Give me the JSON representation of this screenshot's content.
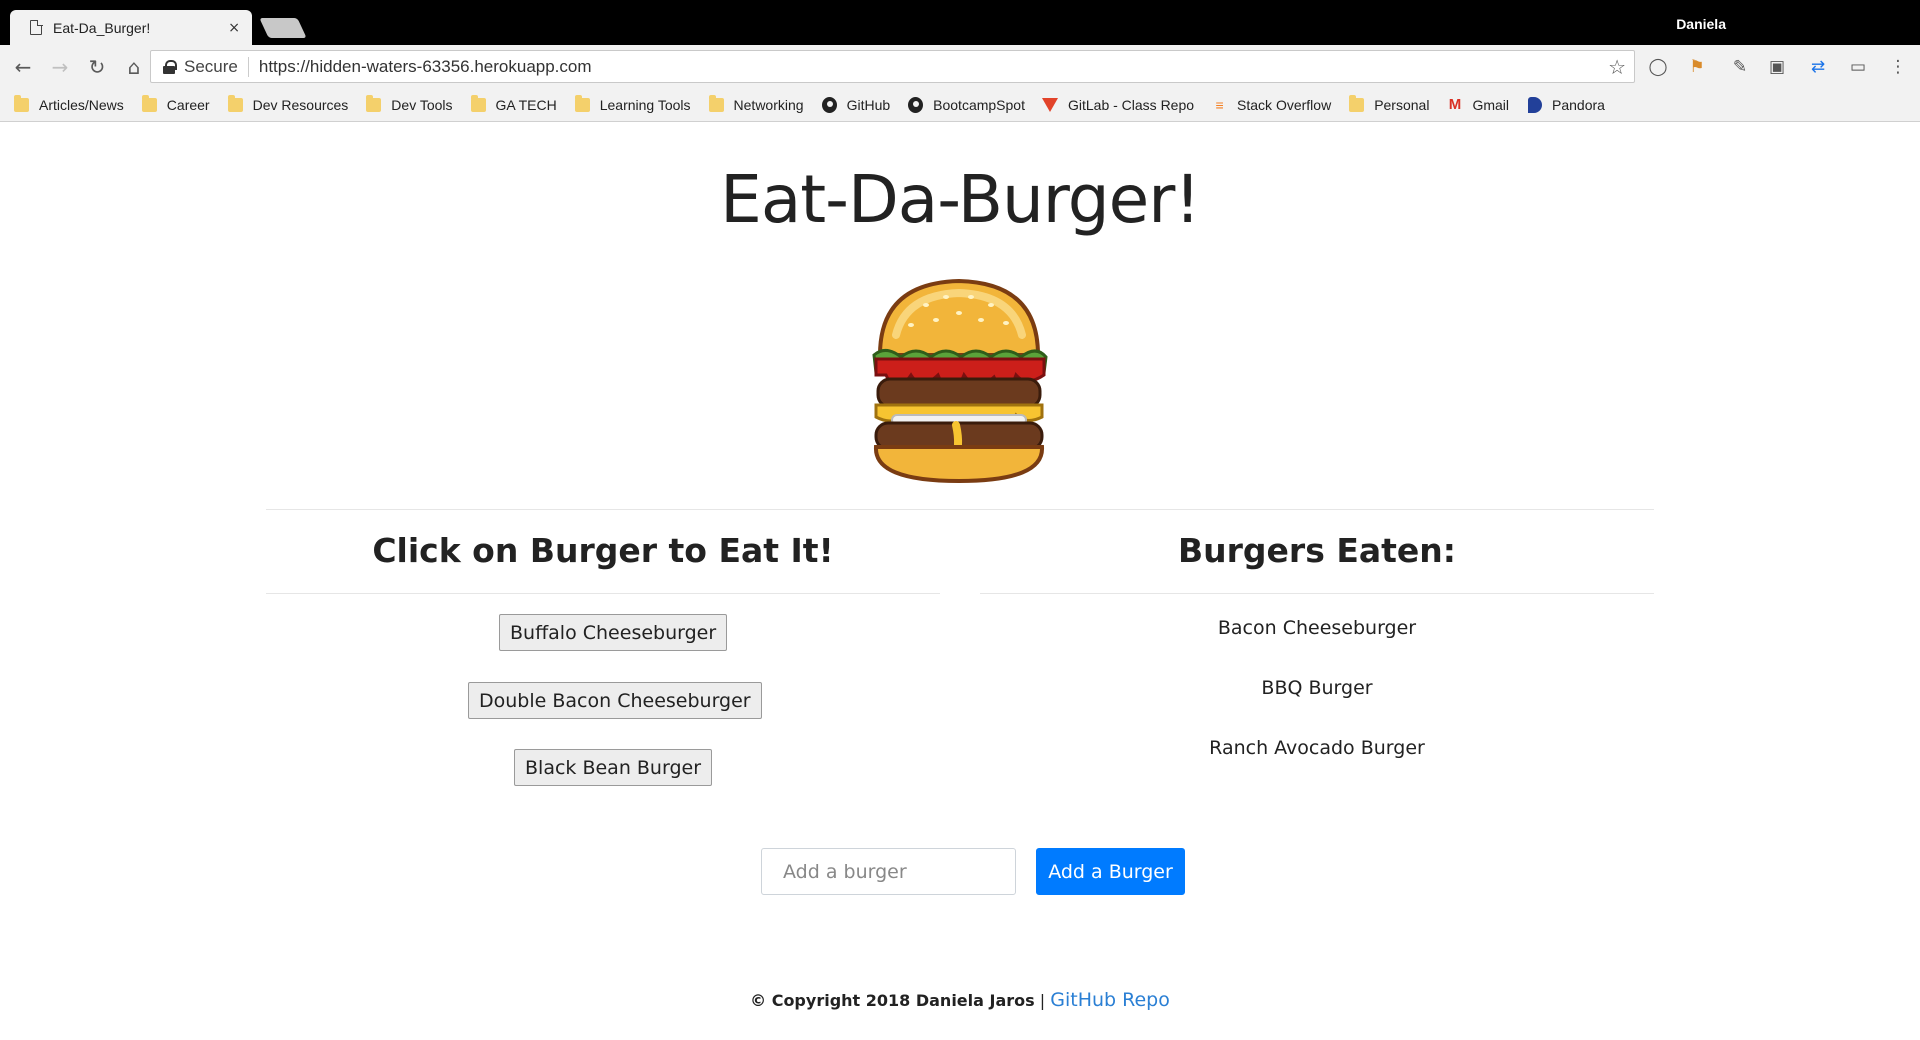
{
  "browser": {
    "tab_title": "Eat-Da_Burger!",
    "tab_close": "×",
    "profile_name": "Daniela",
    "secure_label": "Secure",
    "url": "https://hidden-waters-63356.herokuapp.com",
    "icons": {
      "back": "arrow-left-icon",
      "forward": "arrow-right-icon",
      "reload": "reload-icon",
      "home": "home-icon",
      "star": "star-icon"
    }
  },
  "bookmarks": [
    {
      "label": "Articles/News",
      "icon": "folder"
    },
    {
      "label": "Career",
      "icon": "folder"
    },
    {
      "label": "Dev Resources",
      "icon": "folder"
    },
    {
      "label": "Dev Tools",
      "icon": "folder"
    },
    {
      "label": "GA TECH",
      "icon": "folder"
    },
    {
      "label": "Learning Tools",
      "icon": "folder"
    },
    {
      "label": "Networking",
      "icon": "folder"
    },
    {
      "label": "GitHub",
      "icon": "github"
    },
    {
      "label": "BootcampSpot",
      "icon": "github"
    },
    {
      "label": "GitLab - Class Repo",
      "icon": "gitlab"
    },
    {
      "label": "Stack Overflow",
      "icon": "stackoverflow"
    },
    {
      "label": "Personal",
      "icon": "folder"
    },
    {
      "label": "Gmail",
      "icon": "gmail"
    },
    {
      "label": "Pandora",
      "icon": "pandora"
    }
  ],
  "page": {
    "title": "Eat-Da-Burger!",
    "left_heading": "Click on Burger to Eat It!",
    "right_heading": "Burgers Eaten:",
    "uneaten": [
      "Buffalo Cheeseburger",
      "Double Bacon Cheeseburger",
      "Black Bean Burger"
    ],
    "eaten": [
      "Bacon Cheeseburger",
      "BBQ Burger",
      "Ranch Avocado Burger"
    ],
    "input_placeholder": "Add a burger",
    "add_button": "Add a Burger",
    "footer_copyright": "© Copyright 2018 Daniela Jaros",
    "footer_sep": "|",
    "footer_link": "GitHub Repo",
    "colors": {
      "primary": "#007bff",
      "link": "#2a7fd4"
    }
  }
}
